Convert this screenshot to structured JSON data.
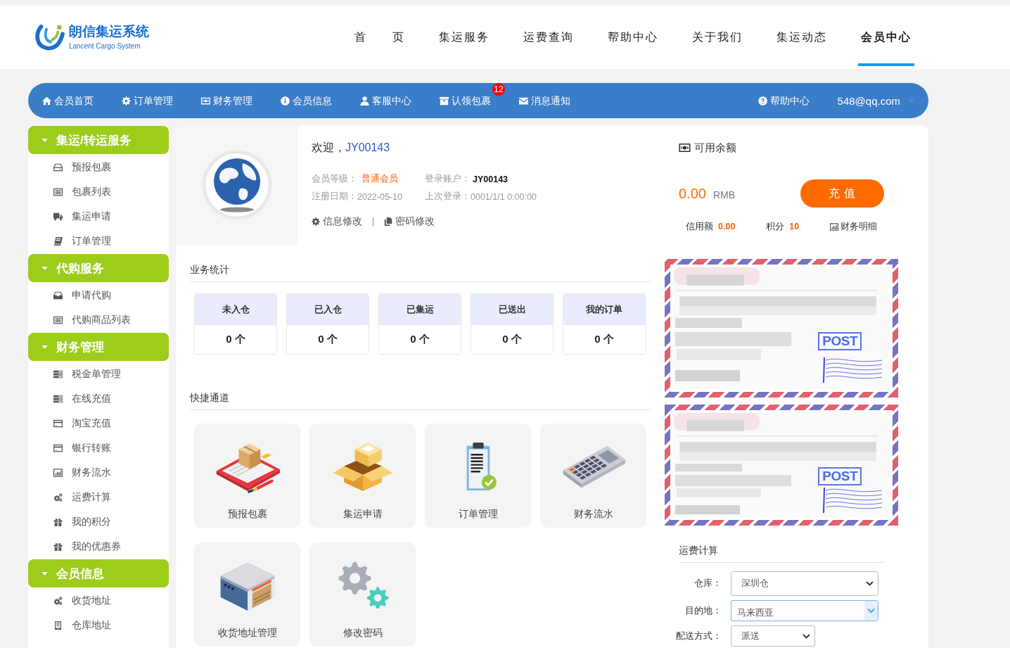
{
  "header": {
    "logo": {
      "name": "朗信集运系统",
      "tagline": "Lancent Cargo System"
    },
    "nav": [
      {
        "label": "首　　页",
        "selected": false
      },
      {
        "label": "集运服务",
        "selected": false
      },
      {
        "label": "运费查询",
        "selected": false
      },
      {
        "label": "帮助中心",
        "selected": false
      },
      {
        "label": "关于我们",
        "selected": false
      },
      {
        "label": "集运动态",
        "selected": false
      },
      {
        "label": "会员中心",
        "selected": true
      }
    ]
  },
  "member_bar": {
    "items": [
      {
        "label": "会员首页"
      },
      {
        "label": "订单管理"
      },
      {
        "label": "财务管理"
      },
      {
        "label": "会员信息"
      },
      {
        "label": "客服中心"
      },
      {
        "label": "认领包裹",
        "badge": "12"
      },
      {
        "label": "消息通知"
      }
    ],
    "help": "帮助中心",
    "account": "548@qq.com"
  },
  "sidebar": {
    "groups": [
      {
        "title": "集运/转运服务",
        "expanded": true,
        "items": [
          "预报包裹",
          "包裹列表",
          "集运申请",
          "订单管理"
        ]
      },
      {
        "title": "代购服务",
        "expanded": true,
        "items": [
          "申请代购",
          "代购商品列表"
        ]
      },
      {
        "title": "财务管理",
        "expanded": true,
        "items": [
          "税金单管理",
          "在线充值",
          "淘宝充值",
          "银行转账",
          "财务流水",
          "运费计算",
          "我的积分",
          "我的优惠券"
        ]
      },
      {
        "title": "会员信息",
        "expanded": true,
        "items": [
          "收货地址",
          "仓库地址"
        ]
      }
    ]
  },
  "profile": {
    "greeting": "欢迎，",
    "username": "JY00143",
    "fields": [
      {
        "label": "会员等级：",
        "value": "普通会员"
      },
      {
        "label": "登录账户：",
        "value": "JY00143"
      },
      {
        "label": "注册日期：",
        "value": "2022-05-10"
      },
      {
        "label": "上次登录：",
        "value": "0001/1/1 0:00:00"
      }
    ],
    "links": [
      "信息修改",
      "密码修改"
    ]
  },
  "balance": {
    "title": "可用余额",
    "amount": "0.00",
    "currency": "RMB",
    "recharge_button": "充 值",
    "stats": [
      {
        "label": "信用额",
        "value": "0.00"
      },
      {
        "label": "积分",
        "value": "10"
      }
    ],
    "details_link": "财务明细"
  },
  "business_stats": {
    "title": "业务统计",
    "cards": [
      {
        "label": "未入仓",
        "value": "0 个"
      },
      {
        "label": "已入仓",
        "value": "0 个"
      },
      {
        "label": "已集运",
        "value": "0 个"
      },
      {
        "label": "已送出",
        "value": "0 个"
      },
      {
        "label": "我的订单",
        "value": "0 个"
      }
    ]
  },
  "quick_access": {
    "title": "快捷通道",
    "tiles": [
      "预报包裹",
      "集运申请",
      "订单管理",
      "财务流水",
      "收货地址管理",
      "修改密码"
    ]
  },
  "envelopes": [
    {
      "stamp": "POST"
    },
    {
      "stamp": "POST"
    }
  ],
  "freight_calculator": {
    "title": "运费计算",
    "fields": [
      {
        "label": "仓库：",
        "value": "深圳仓",
        "focused": false
      },
      {
        "label": "目的地：",
        "value": "马来西亚",
        "focused": true
      },
      {
        "label": "配送方式：",
        "value": "派送",
        "focused": false
      }
    ]
  }
}
